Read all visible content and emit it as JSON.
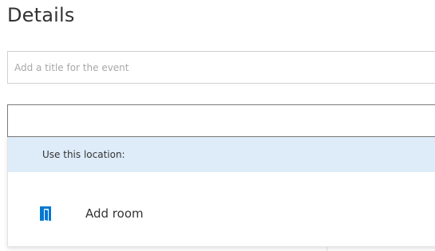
{
  "section": {
    "title": "Details"
  },
  "event_title": {
    "value": "",
    "placeholder": "Add a title for the event"
  },
  "location": {
    "value": "",
    "placeholder": ""
  },
  "location_dropdown": {
    "header": "Use this location:",
    "items": [
      {
        "label": "Add room",
        "icon": "room-door-icon"
      }
    ]
  },
  "colors": {
    "accent": "#0078d4",
    "header_bg": "#deecf9"
  }
}
